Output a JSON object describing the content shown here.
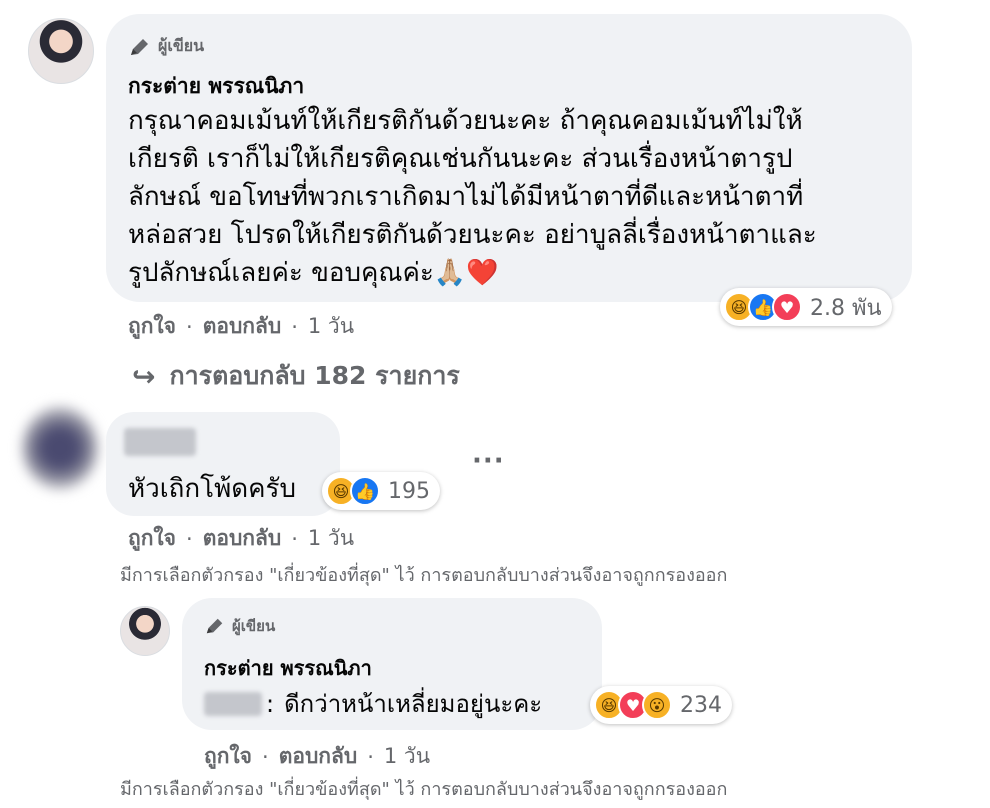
{
  "comment1": {
    "author_badge": "ผู้เขียน",
    "author_name": "กระต่าย พรรณนิภา",
    "lines": [
      "กรุณาคอมเม้นท์ให้เกียรติกันด้วยนะคะ ถ้าคุณคอมเม้นท์ไม่ให้",
      "เกียรติ เราก็ไม่ให้เกียรติคุณเช่นกันนะคะ ส่วนเรื่องหน้าตารูป",
      "ลักษณ์ ขอโทษที่พวกเราเกิดมาไม่ได้มีหน้าตาที่ดีและหน้าตาที่",
      "หล่อสวย โปรดให้เกียรติกันด้วยนะคะ อย่าบูลลี่เรื่องหน้าตาและ",
      "รูปลักษณ์เลยค่ะ ขอบคุณค่ะ🙏🏼❤️"
    ],
    "reaction_count": "2.8 พัน",
    "like_label": "ถูกใจ",
    "dot": "·",
    "reply_label": "ตอบกลับ",
    "time": "1 วัน",
    "replies_arrow": "↪",
    "replies_label": "การตอบกลับ 182 รายการ"
  },
  "comment2": {
    "text": "หัวเถิกโพ้ดครับ",
    "reaction_count": "195",
    "more": "···",
    "like_label": "ถูกใจ",
    "dot": "·",
    "reply_label": "ตอบกลับ",
    "time": "1 วัน",
    "filter_note": "มีการเลือกตัวกรอง \"เกี่ยวข้องที่สุด\" ไว้ การตอบกลับบางส่วนจึงอาจถูกกรองออก"
  },
  "reply1": {
    "author_badge": "ผู้เขียน",
    "author_name": "กระต่าย พรรณนิภา",
    "mention_suffix": ":",
    "text": "ดีกว่าหน้าเหลี่ยมอยู่นะคะ",
    "reaction_count": "234",
    "like_label": "ถูกใจ",
    "dot": "·",
    "reply_label": "ตอบกลับ",
    "time": "1 วัน",
    "filter_note": "มีการเลือกตัวกรอง \"เกี่ยวข้องที่สุด\" ไว้ การตอบกลับบางส่วนจึงอาจถูกกรองออก"
  },
  "icons": {
    "pen": "pen-icon",
    "haha": "😆",
    "like": "👍",
    "love": "♥",
    "wow": "😮"
  },
  "colors": {
    "bubble": "#f0f2f5",
    "secondary_text": "#65676b",
    "like_blue": "#1877f2",
    "love_red": "#f33e58",
    "haha_yellow": "#f7b125"
  }
}
